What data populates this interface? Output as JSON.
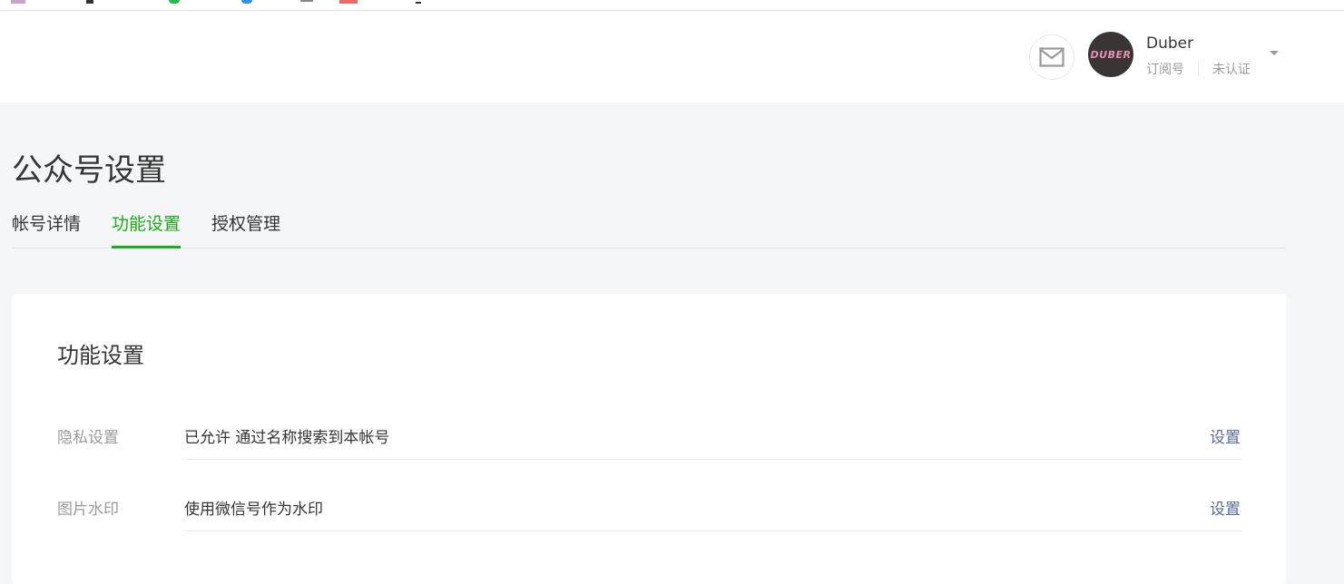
{
  "header": {
    "account_name": "Duber",
    "account_type": "订阅号",
    "verification": "未认证",
    "avatar_text": "DUBER",
    "mail_icon": "mail-icon",
    "caret_icon": "chevron-down-icon"
  },
  "page": {
    "title": "公众号设置",
    "tabs": [
      {
        "label": "帐号详情"
      },
      {
        "label": "功能设置",
        "active": true
      },
      {
        "label": "授权管理"
      }
    ]
  },
  "card": {
    "title": "功能设置",
    "rows": [
      {
        "label": "隐私设置",
        "value": "已允许 通过名称搜索到本帐号",
        "action": "设置"
      },
      {
        "label": "图片水印",
        "value": "使用微信号作为水印",
        "action": "设置"
      }
    ]
  },
  "colors": {
    "accent": "#1aad19",
    "link": "#576b95",
    "page_bg": "#f5f6f7"
  }
}
